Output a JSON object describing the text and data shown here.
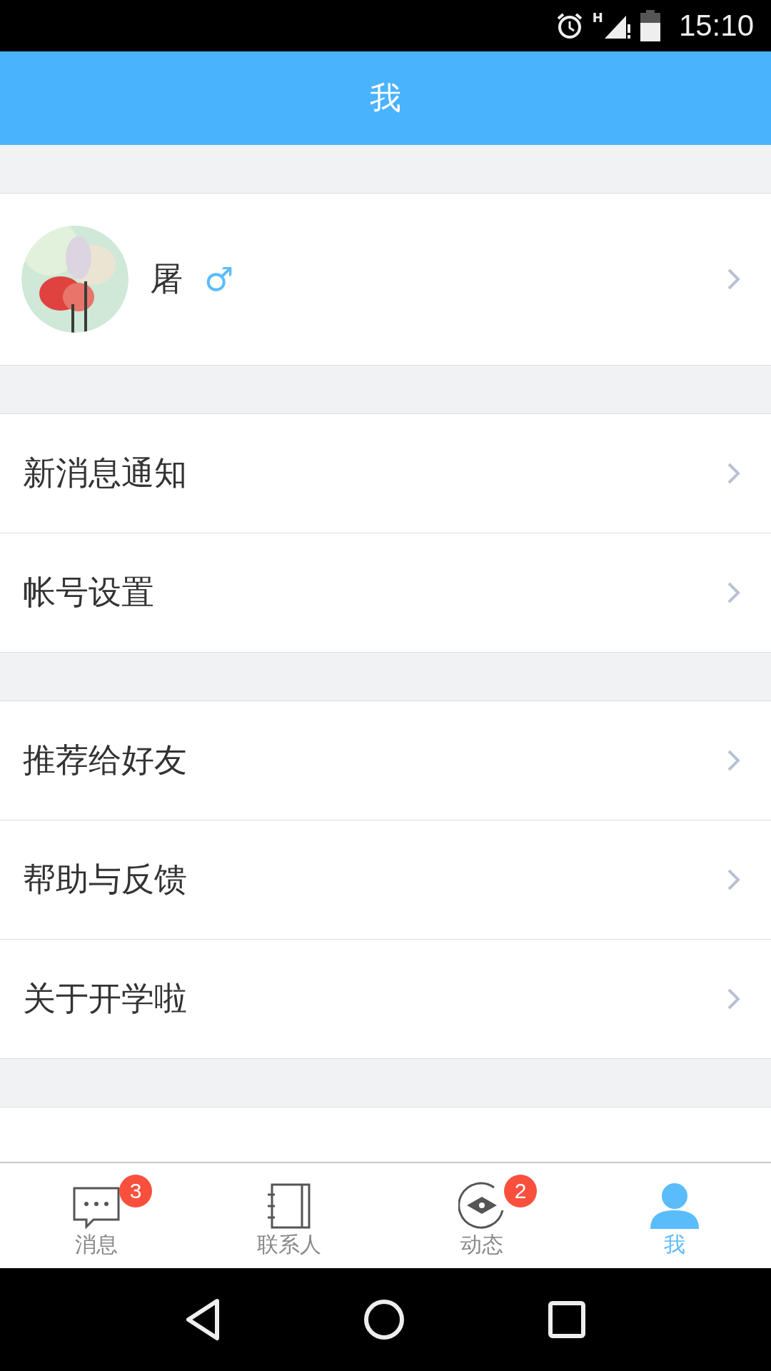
{
  "status_bar": {
    "time": "15:10",
    "network": "H"
  },
  "header": {
    "title": "我"
  },
  "profile": {
    "name": "屠",
    "gender": "♂"
  },
  "menu_groups": [
    [
      {
        "label": "新消息通知"
      },
      {
        "label": "帐号设置"
      }
    ],
    [
      {
        "label": "推荐给好友"
      },
      {
        "label": "帮助与反馈"
      },
      {
        "label": "关于开学啦"
      }
    ]
  ],
  "tabs": [
    {
      "label": "消息",
      "kind": "chat",
      "badge": "3",
      "selected": false
    },
    {
      "label": "联系人",
      "kind": "book",
      "selected": false
    },
    {
      "label": "动态",
      "kind": "eye",
      "badge": "2",
      "selected": false
    },
    {
      "label": "我",
      "kind": "person",
      "selected": true
    }
  ]
}
